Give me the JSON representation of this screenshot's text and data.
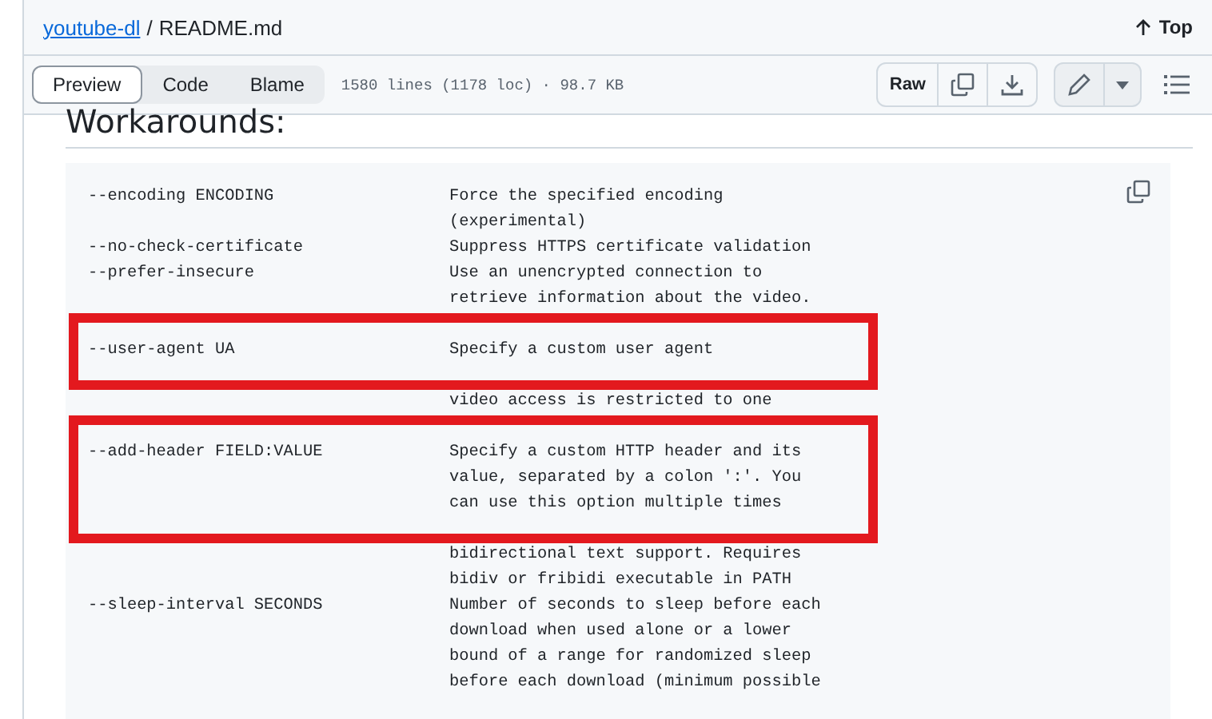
{
  "breadcrumb": {
    "repo": "youtube-dl",
    "separator": "/",
    "file": "README.md"
  },
  "top_link": "Top",
  "view_tabs": [
    {
      "label": "Preview",
      "selected": true
    },
    {
      "label": "Code",
      "selected": false
    },
    {
      "label": "Blame",
      "selected": false
    }
  ],
  "file_info": "1580 lines (1178 loc) · 98.7 KB",
  "raw_button": "Raw",
  "heading": "Workarounds:",
  "code_lines": [
    {
      "kind": "text",
      "option": "--encoding ENCODING",
      "description": "Force the specified encoding",
      "highlighted": false
    },
    {
      "kind": "text",
      "description": "(experimental)",
      "highlighted": false
    },
    {
      "kind": "text",
      "option": "--no-check-certificate",
      "description": "Suppress HTTPS certificate validation",
      "highlighted": false
    },
    {
      "kind": "text",
      "option": "--prefer-insecure",
      "description": "Use an unencrypted connection to",
      "highlighted": false
    },
    {
      "kind": "text",
      "description": "retrieve information about the video.",
      "highlighted": false
    },
    {
      "kind": "covered",
      "highlighted": true
    },
    {
      "kind": "text",
      "option": "--user-agent UA",
      "description": "Specify a custom user agent",
      "highlighted": true
    },
    {
      "kind": "covered",
      "highlighted": true
    },
    {
      "kind": "text",
      "description": "video access is restricted to one",
      "highlighted": false
    },
    {
      "kind": "covered",
      "highlighted": true
    },
    {
      "kind": "text",
      "option": "--add-header FIELD:VALUE",
      "description": "Specify a custom HTTP header and its",
      "highlighted": true
    },
    {
      "kind": "text",
      "description": "value, separated by a colon ':'. You",
      "highlighted": true
    },
    {
      "kind": "text",
      "description": "can use this option multiple times",
      "highlighted": true
    },
    {
      "kind": "covered",
      "highlighted": true
    },
    {
      "kind": "text",
      "description": "bidirectional text support. Requires",
      "highlighted": false
    },
    {
      "kind": "text",
      "description": "bidiv or fribidi executable in PATH",
      "highlighted": false
    },
    {
      "kind": "text",
      "option": "--sleep-interval SECONDS",
      "description": "Number of seconds to sleep before each",
      "highlighted": false
    },
    {
      "kind": "text",
      "description": "download when used alone or a lower",
      "highlighted": false
    },
    {
      "kind": "text",
      "description": "bound of a range for randomized sleep",
      "highlighted": false
    },
    {
      "kind": "text",
      "description": "before each download (minimum possible",
      "highlighted": false
    }
  ]
}
